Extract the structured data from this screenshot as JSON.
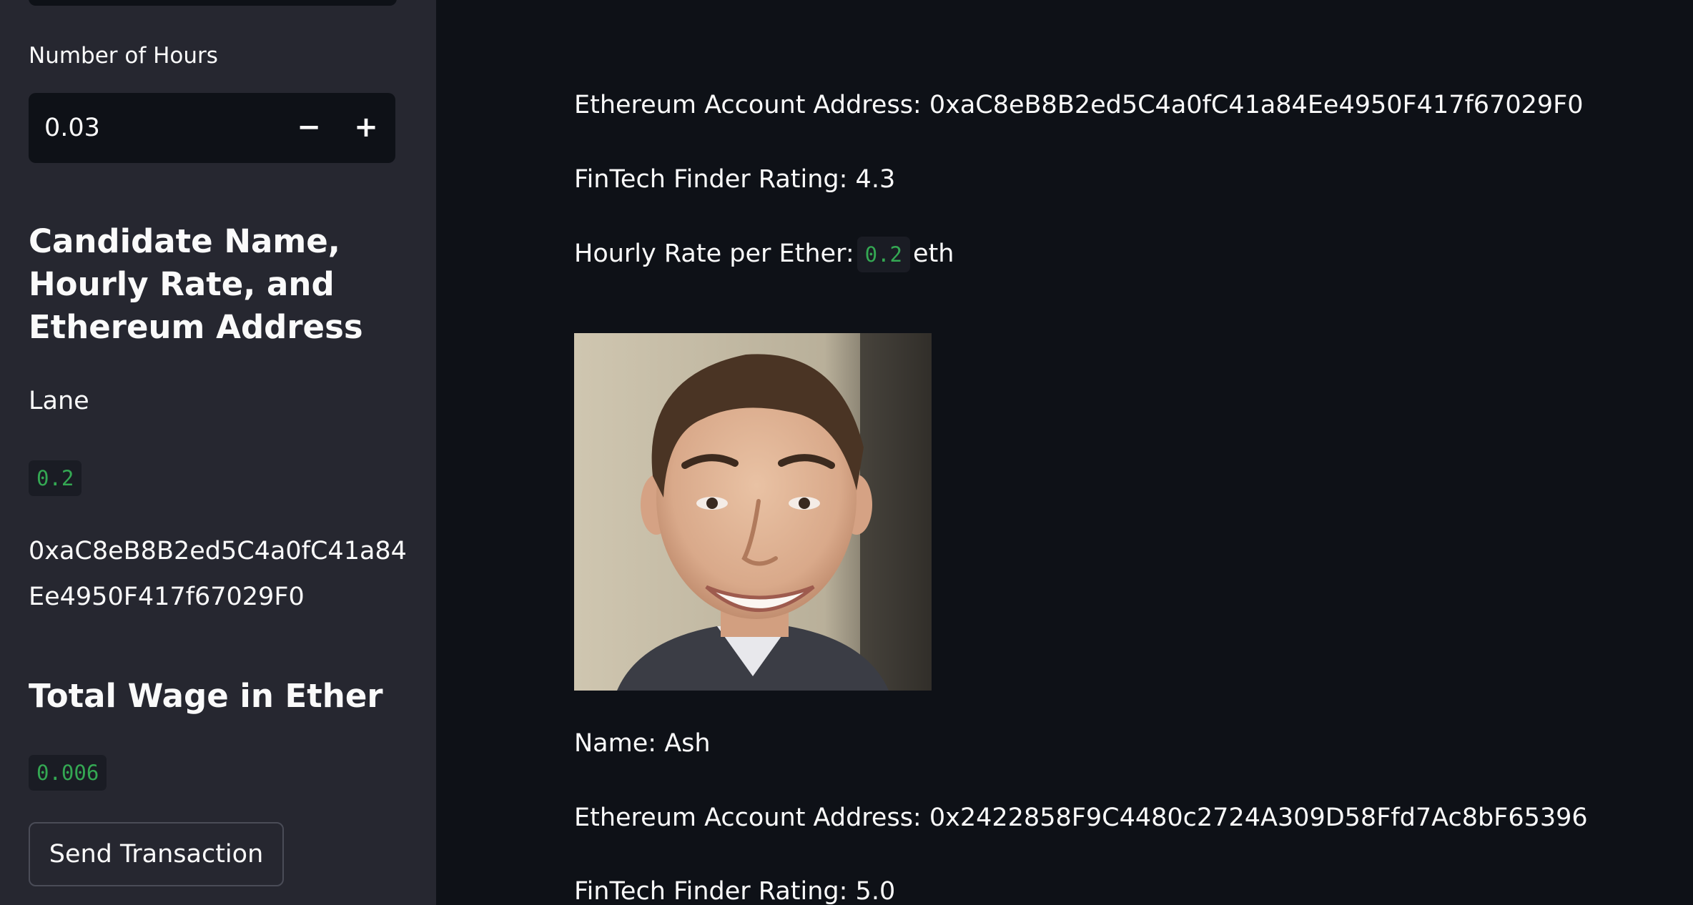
{
  "sidebar": {
    "hours_label": "Number of Hours",
    "hours_value": "0.03",
    "decrement_label": "−",
    "increment_label": "+",
    "candidate_heading": "Candidate Name, Hourly Rate, and Ethereum Address",
    "candidate_name": "Lane",
    "candidate_rate": "0.2",
    "candidate_address": "0xaC8eB8B2ed5C4a0fC41a84Ee4950F417f67029F0",
    "wage_heading": "Total Wage in Ether",
    "wage_value": "0.006",
    "send_button_label": "Send Transaction"
  },
  "main": {
    "candidate1": {
      "address_label": "Ethereum Account Address:",
      "address": "0xaC8eB8B2ed5C4a0fC41a84Ee4950F417f67029F0",
      "rating_label": "FinTech Finder Rating:",
      "rating": "4.3",
      "rate_label": "Hourly Rate per Ether:",
      "rate": "0.2",
      "rate_unit": "eth"
    },
    "candidate2": {
      "name_label": "Name:",
      "name": "Ash",
      "address_label": "Ethereum Account Address:",
      "address": "0x2422858F9C4480c2724A309D58Ffd7Ac8bF65396",
      "rating_label": "FinTech Finder Rating:",
      "rating": "5.0"
    }
  }
}
